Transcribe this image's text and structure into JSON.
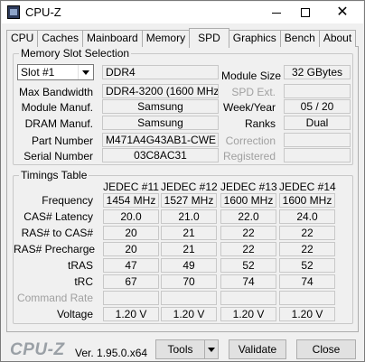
{
  "window": {
    "title": "CPU-Z",
    "minimize_icon": "minimize-icon",
    "maximize_icon": "maximize-icon",
    "close_icon": "close-icon",
    "close_glyph": "✕"
  },
  "tabs": [
    {
      "label": "CPU"
    },
    {
      "label": "Caches"
    },
    {
      "label": "Mainboard"
    },
    {
      "label": "Memory"
    },
    {
      "label": "SPD",
      "active": true
    },
    {
      "label": "Graphics"
    },
    {
      "label": "Bench"
    },
    {
      "label": "About"
    }
  ],
  "slot_selection": {
    "group_label": "Memory Slot Selection",
    "slot_value": "Slot #1",
    "memory_type": "DDR4",
    "labels": {
      "max_bandwidth": "Max Bandwidth",
      "module_manuf": "Module Manuf.",
      "dram_manuf": "DRAM Manuf.",
      "part_number": "Part Number",
      "serial_number": "Serial Number",
      "module_size": "Module Size",
      "spd_ext": "SPD Ext.",
      "week_year": "Week/Year",
      "ranks": "Ranks",
      "correction": "Correction",
      "registered": "Registered"
    },
    "values": {
      "max_bandwidth": "DDR4-3200 (1600 MHz)",
      "module_manuf": "Samsung",
      "dram_manuf": "Samsung",
      "part_number": "M471A4G43AB1-CWE",
      "serial_number": "03C8AC31",
      "module_size": "32 GBytes",
      "spd_ext": "",
      "week_year": "05 / 20",
      "ranks": "Dual",
      "correction": "",
      "registered": ""
    }
  },
  "timings": {
    "group_label": "Timings Table",
    "columns": [
      "JEDEC #11",
      "JEDEC #12",
      "JEDEC #13",
      "JEDEC #14"
    ],
    "rows": [
      {
        "label": "Frequency",
        "dim": false,
        "values": [
          "1454 MHz",
          "1527 MHz",
          "1600 MHz",
          "1600 MHz"
        ]
      },
      {
        "label": "CAS# Latency",
        "dim": false,
        "values": [
          "20.0",
          "21.0",
          "22.0",
          "24.0"
        ]
      },
      {
        "label": "RAS# to CAS#",
        "dim": false,
        "values": [
          "20",
          "21",
          "22",
          "22"
        ]
      },
      {
        "label": "RAS# Precharge",
        "dim": false,
        "values": [
          "20",
          "21",
          "22",
          "22"
        ]
      },
      {
        "label": "tRAS",
        "dim": false,
        "values": [
          "47",
          "49",
          "52",
          "52"
        ]
      },
      {
        "label": "tRC",
        "dim": false,
        "values": [
          "67",
          "70",
          "74",
          "74"
        ]
      },
      {
        "label": "Command Rate",
        "dim": true,
        "values": [
          "",
          "",
          "",
          ""
        ]
      },
      {
        "label": "Voltage",
        "dim": false,
        "values": [
          "1.20 V",
          "1.20 V",
          "1.20 V",
          "1.20 V"
        ]
      }
    ]
  },
  "footer": {
    "logo": "CPU-Z",
    "version": "Ver. 1.95.0.x64",
    "tools_label": "Tools",
    "validate_label": "Validate",
    "close_label": "Close"
  }
}
